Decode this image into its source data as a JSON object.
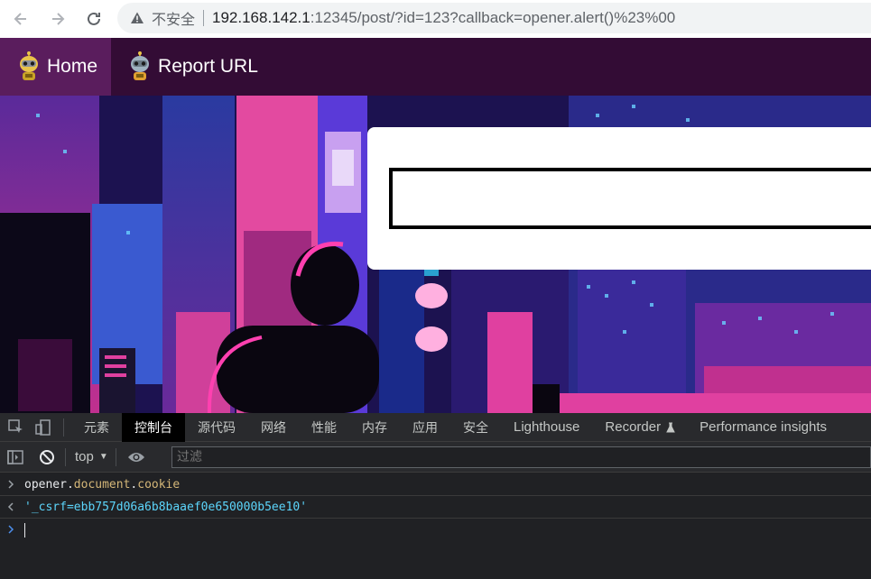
{
  "browser": {
    "insecure_label": "不安全",
    "url_host": "192.168.142.1",
    "url_rest": ":12345/post/?id=123?callback=opener.alert()%23%00"
  },
  "site_nav": {
    "items": [
      {
        "label": "Home",
        "active": true
      },
      {
        "label": "Report URL",
        "active": false
      }
    ]
  },
  "hero": {
    "search_value": ""
  },
  "devtools": {
    "tabs": [
      {
        "label": "元素",
        "active": false
      },
      {
        "label": "控制台",
        "active": true
      },
      {
        "label": "源代码",
        "active": false
      },
      {
        "label": "网络",
        "active": false
      },
      {
        "label": "性能",
        "active": false
      },
      {
        "label": "内存",
        "active": false
      },
      {
        "label": "应用",
        "active": false
      },
      {
        "label": "安全",
        "active": false
      },
      {
        "label": "Lighthouse",
        "active": false
      },
      {
        "label": "Recorder",
        "active": false
      },
      {
        "label": "Performance insights",
        "active": false
      }
    ],
    "context": "top",
    "filter_placeholder": "过滤",
    "console": {
      "input_obj": "opener",
      "input_dot1": ".",
      "input_prop1": "document",
      "input_dot2": ".",
      "input_prop2": "cookie",
      "output": "'_csrf=ebb757d06a6b8baaef0e650000b5ee10'"
    }
  },
  "colors": {
    "nav_bg": "#330c35",
    "nav_active": "#5a1d5d",
    "string": "#5cd5fb",
    "property": "#d5b778"
  }
}
